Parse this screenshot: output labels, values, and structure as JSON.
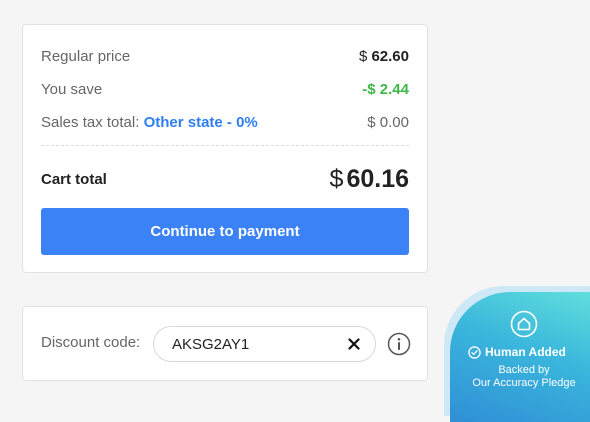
{
  "summary": {
    "regular_price_label": "Regular price",
    "regular_price_currency": "$",
    "regular_price_value": "62.60",
    "you_save_label": "You save",
    "you_save_value": "-$ 2.44",
    "sales_tax_label": "Sales tax total:",
    "sales_tax_region": "Other state - 0%",
    "sales_tax_value": "$ 0.00",
    "cart_total_label": "Cart total",
    "cart_total_currency": "$",
    "cart_total_value": "60.16",
    "pay_button_label": "Continue to payment"
  },
  "discount": {
    "label": "Discount code:",
    "value": "AKSG2AY1"
  },
  "badge": {
    "title": "Human Added",
    "line1": "Backed by",
    "line2": "Our Accuracy Pledge"
  },
  "colors": {
    "accent": "#3b82f6",
    "link": "#2f7ff0",
    "savings": "#3fb848"
  },
  "icons": [
    "close-icon",
    "info-icon",
    "house-icon",
    "check-circle-icon"
  ]
}
